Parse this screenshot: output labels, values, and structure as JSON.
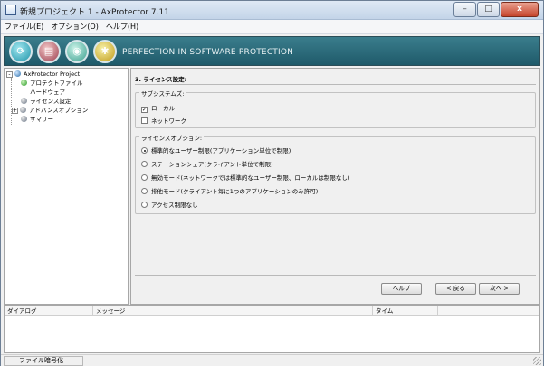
{
  "window": {
    "title": "新規プロジェクト 1 - AxProtector 7.11",
    "minimize_glyph": "–",
    "maximize_glyph": "□",
    "close_glyph": "x"
  },
  "menu": {
    "items": [
      {
        "label": "ファイル(E)"
      },
      {
        "label": "オプション(O)"
      },
      {
        "label": "ヘルプ(H)"
      }
    ]
  },
  "banner": {
    "text": "PERFECTION IN SOFTWARE PROTECTION",
    "icons": [
      "refresh-icon",
      "page-icon",
      "shield-icon",
      "gear-icon"
    ]
  },
  "tree": {
    "root": {
      "label": "AxProtector Project",
      "expander": "-"
    },
    "items": [
      {
        "label": "プロテクトファイル",
        "icon": "ok-icon"
      },
      {
        "label": "ハードウェア",
        "icon": "none"
      },
      {
        "label": "ライセンス設定",
        "icon": "gear-icon"
      },
      {
        "label": "アドバンスオプション",
        "icon": "gear-icon",
        "expander": "+"
      },
      {
        "label": "サマリー",
        "icon": "gear-icon"
      }
    ]
  },
  "content": {
    "section_title": "3. ライセンス設定:",
    "subsystems": {
      "legend": "サブシステムズ:",
      "options": [
        {
          "label": "ローカル",
          "checked": true
        },
        {
          "label": "ネットワーク",
          "checked": false
        }
      ]
    },
    "license_options": {
      "legend": "ライセンスオプション:",
      "options": [
        {
          "label": "標準的なユーザー制限(アプリケーション単位で制限)",
          "selected": true
        },
        {
          "label": "ステーションシェア(クライアント単位で制限)",
          "selected": false
        },
        {
          "label": "無効モード(ネットワークでは標準的なユーザー制限、ローカルは制限なし)",
          "selected": false
        },
        {
          "label": "排他モード(クライアント毎に1つのアプリケーションのみ許可)",
          "selected": false
        },
        {
          "label": "アクセス制限なし",
          "selected": false
        }
      ]
    },
    "buttons": {
      "help": "ヘルプ",
      "back": "< 戻る",
      "next": "次へ >"
    }
  },
  "log": {
    "columns": [
      "ダイアログ",
      "メッセージ",
      "タイム"
    ]
  },
  "statusbar": {
    "label": "ファイル暗号化"
  }
}
